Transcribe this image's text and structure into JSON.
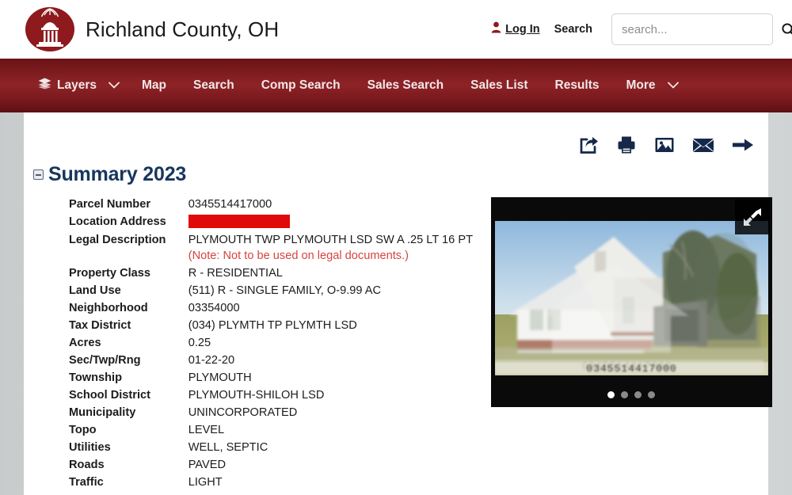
{
  "header": {
    "logo_alt": "county-courthouse-logo",
    "title": "Richland County, OH",
    "login_label": "Log In",
    "search_label": "Search",
    "search_placeholder": "search...",
    "search_value": "",
    "brand_color": "#8e1a1e"
  },
  "nav": {
    "items": [
      {
        "label": "Layers",
        "icon": "layers-icon",
        "caret": true
      },
      {
        "label": "Map",
        "icon": "",
        "caret": false
      },
      {
        "label": "Search",
        "icon": "",
        "caret": false
      },
      {
        "label": "Comp Search",
        "icon": "",
        "caret": false
      },
      {
        "label": "Sales Search",
        "icon": "",
        "caret": false
      },
      {
        "label": "Sales List",
        "icon": "",
        "caret": false
      },
      {
        "label": "Results",
        "icon": "",
        "caret": false
      },
      {
        "label": "More",
        "icon": "",
        "caret": true
      }
    ],
    "bar_color": "#8d2327"
  },
  "toolbar": {
    "icons": [
      {
        "name": "share-icon",
        "title": "Share"
      },
      {
        "name": "print-icon",
        "title": "Print"
      },
      {
        "name": "image-icon",
        "title": "Images"
      },
      {
        "name": "email-icon",
        "title": "Email"
      },
      {
        "name": "arrow-right-icon",
        "title": "Next"
      }
    ]
  },
  "summary": {
    "heading": "Summary 2023",
    "collapsed": false,
    "rows": [
      {
        "label": "Parcel Number",
        "value": "0345514417000",
        "redacted": false
      },
      {
        "label": "Location Address",
        "value": "",
        "redacted": true
      },
      {
        "label": "Legal Description",
        "value": "PLYMOUTH TWP PLYMOUTH LSD SW A .25 LT 16 PT",
        "redacted": false,
        "note": "(Note: Not to be used on legal documents.)"
      },
      {
        "label": "Property Class",
        "value": "R - RESIDENTIAL",
        "redacted": false
      },
      {
        "label": "Land Use",
        "value": "(511) R - SINGLE FAMILY, O-9.99 AC",
        "redacted": false
      },
      {
        "label": "Neighborhood",
        "value": "03354000",
        "redacted": false
      },
      {
        "label": "Tax District",
        "value": "(034) PLYMTH TP PLYMTH LSD",
        "redacted": false
      },
      {
        "label": "Acres",
        "value": "0.25",
        "redacted": false
      },
      {
        "label": "Sec/Twp/Rng",
        "value": "01-22-20",
        "redacted": false
      },
      {
        "label": "Township",
        "value": "PLYMOUTH",
        "redacted": false
      },
      {
        "label": "School District",
        "value": "PLYMOUTH-SHILOH LSD",
        "redacted": false
      },
      {
        "label": "Municipality",
        "value": "UNINCORPORATED",
        "redacted": false
      },
      {
        "label": "Topo",
        "value": "LEVEL",
        "redacted": false
      },
      {
        "label": "Utilities",
        "value": "WELL, SEPTIC",
        "redacted": false
      },
      {
        "label": "Roads",
        "value": "PAVED",
        "redacted": false
      },
      {
        "label": "Traffic",
        "value": "LIGHT",
        "redacted": false
      }
    ],
    "note_color": "#d9433f",
    "redaction_color": "#e10a0a"
  },
  "photo": {
    "caption_overlay": "0345514417000",
    "caption_overlay_alt": "0345514417000",
    "expand_icon": "expand-arrow-icon",
    "dot_count": 4,
    "active_dot": 1,
    "alt": "property-photo-white-house"
  }
}
